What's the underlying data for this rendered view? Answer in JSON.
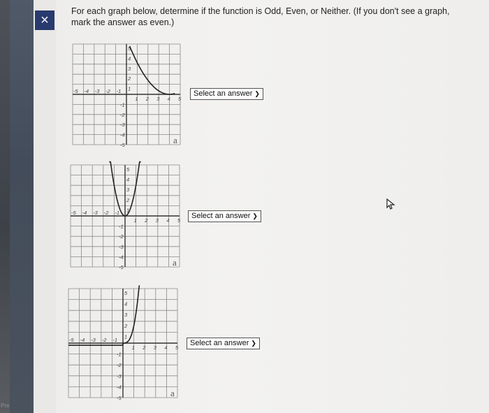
{
  "app": {
    "left_strip_label": "Pre",
    "close_label": "×"
  },
  "instructions": "For each graph below, determine if the function is Odd, Even, or Neither. (If you don't see a graph, mark the answer as even.)",
  "axis_ticks": {
    "x_neg": [
      "-5",
      "-4",
      "-3",
      "-2",
      "-1"
    ],
    "x_pos": [
      "1",
      "2",
      "3",
      "4",
      "5"
    ],
    "y_pos": [
      "5",
      "4",
      "3",
      "2",
      "1"
    ],
    "y_neg": [
      "-1",
      "-2",
      "-3",
      "-4",
      "-5"
    ]
  },
  "questions": [
    {
      "graph_label": "a",
      "answer": "Select an answer"
    },
    {
      "graph_label": "a",
      "answer": "Select an answer"
    },
    {
      "graph_label": "a",
      "answer": "Select an answer"
    }
  ],
  "colors": {
    "accent": "#293a6e",
    "grid": "#8a8a8a",
    "curve": "#222222"
  }
}
